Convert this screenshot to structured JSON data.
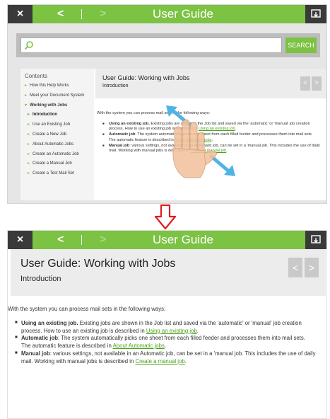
{
  "app": {
    "title": "User Guide",
    "close_label": "×",
    "back_label": "<",
    "forward_label": ">"
  },
  "search": {
    "value": "",
    "button_label": "SEARCH"
  },
  "sidebar": {
    "title": "Contents",
    "items": [
      {
        "label": "How this Help Works"
      },
      {
        "label": "Meet your Document System"
      },
      {
        "label": "Working with Jobs"
      },
      {
        "label": "Introduction"
      },
      {
        "label": "Use an Existing Job"
      },
      {
        "label": "Create a New Job"
      },
      {
        "label": "About Automatic Jobs"
      },
      {
        "label": "Create an Automatic Job"
      },
      {
        "label": "Create a Manual Job"
      },
      {
        "label": "Create a Test Mail Set"
      }
    ]
  },
  "page": {
    "title": "User Guide: Working with Jobs",
    "subtitle": "Introduction",
    "prev_label": "<",
    "next_label": ">",
    "intro": "With the system you can process mail sets in the following ways:",
    "bullets": [
      {
        "term": "Using an existing job.",
        "text": " Existing jobs are shown in the Job list and saved via the 'automatic' or 'manual' job creation process. How to use an existing job is described in ",
        "link": "Using an existing job",
        "after": "."
      },
      {
        "term": "Automatic job",
        "text": ": The system automatically picks one sheet from each filled feeder and processes them into mail sets.",
        "line2": "The automatic feature is described in ",
        "link": "About Automatic jobs",
        "after": "."
      },
      {
        "term": "Manual job",
        "text": ": various settings, not available in an Automatic job, can be set in a 'manual job. This includes the use of daily mail. Working with manual jobs is described in ",
        "link": "Create a manual job",
        "after": "."
      }
    ]
  },
  "gesture": {
    "icon": "pinch-zoom-hand-icon"
  },
  "colors": {
    "accent": "#7cc243",
    "topbar_dark": "#3a3a3a",
    "link": "#4aa11a",
    "arrow": "#e11b1b"
  }
}
